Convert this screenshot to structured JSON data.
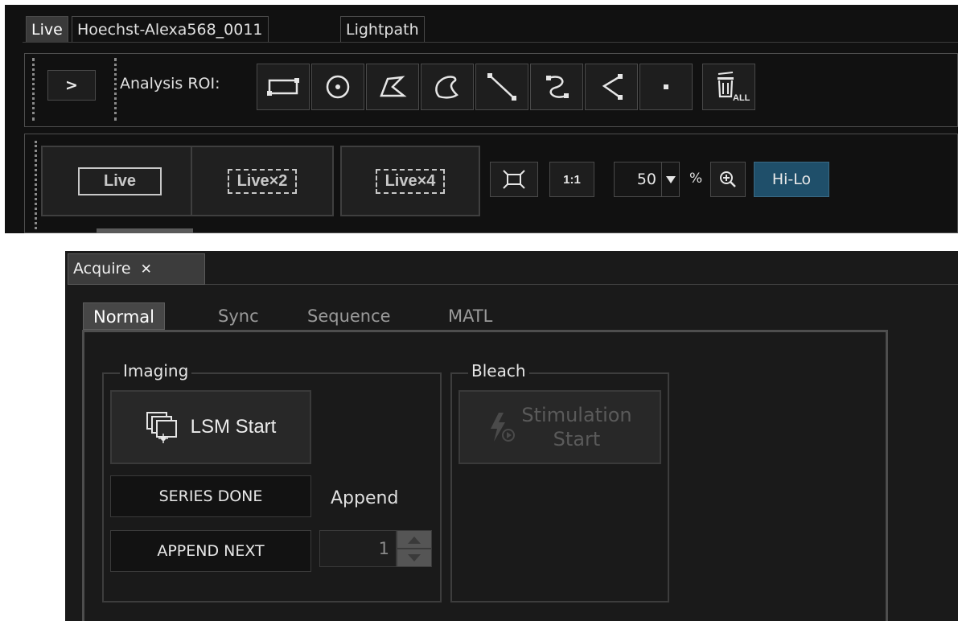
{
  "top": {
    "tabs": [
      {
        "label": "Live",
        "active": true
      },
      {
        "label": "Hoechst-Alexa568_0011",
        "active": false
      },
      {
        "label": "Lightpath",
        "active": false
      }
    ],
    "expand_label": ">",
    "analysis_roi_label": "Analysis ROI:",
    "roi_tools": [
      "rectangle-roi-icon",
      "ellipse-roi-icon",
      "polygon-roi-icon",
      "freehand-roi-icon",
      "line-roi-icon",
      "polyline-roi-icon",
      "freeline-roi-icon",
      "point-roi-icon"
    ],
    "delete_all_sub": "ALL",
    "live_buttons": [
      "Live",
      "Live×2",
      "Live×4"
    ],
    "one_to_one": "1:1",
    "zoom_value": "50",
    "zoom_unit": "%",
    "hilo_label": "Hi-Lo",
    "hilo_color": "#1f4f6a"
  },
  "acquire": {
    "tab_label": "Acquire",
    "close_glyph": "✕",
    "subtabs": [
      {
        "label": "Normal",
        "active": true
      },
      {
        "label": "Sync",
        "active": false
      },
      {
        "label": "Sequence",
        "active": false
      },
      {
        "label": "MATL",
        "active": false
      }
    ],
    "imaging": {
      "title": "Imaging",
      "lsm_start_label": "LSM Start",
      "series_done_label": "SERIES DONE",
      "append_label": "Append",
      "append_next_label": "APPEND NEXT",
      "append_value": "1"
    },
    "bleach": {
      "title": "Bleach",
      "stimulation_line1": "Stimulation",
      "stimulation_line2": "Start"
    }
  }
}
